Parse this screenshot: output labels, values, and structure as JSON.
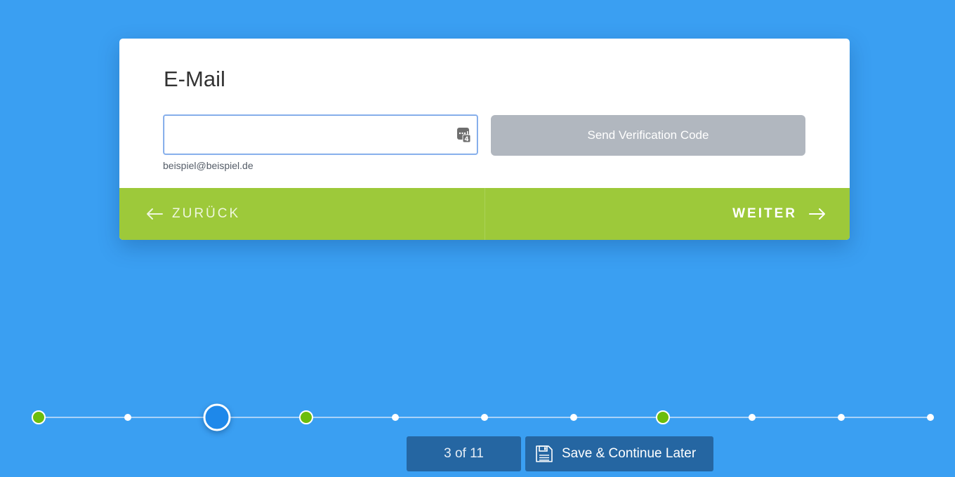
{
  "form": {
    "field_label": "E-Mail",
    "email_value": "",
    "email_placeholder": "",
    "helper_text": "beispiel@beispiel.de",
    "send_code_label": "Send Verification Code"
  },
  "navigation": {
    "back_label": "ZURÜCK",
    "next_label": "WEITER"
  },
  "progress": {
    "current_step": 3,
    "total_steps": 11,
    "counter_text": "3 of 11",
    "step_states": [
      "done",
      "pending",
      "current",
      "done",
      "pending",
      "pending",
      "pending",
      "done",
      "pending",
      "pending",
      "pending"
    ]
  },
  "footer": {
    "save_later_label": "Save & Continue Later"
  },
  "colors": {
    "background": "#3a9ff2",
    "nav_bar": "#9dc93a",
    "step_done": "#6cbd0c",
    "step_current": "#1e88ea",
    "footer_button": "#2566a2",
    "send_button_disabled": "#b1b7bf"
  }
}
